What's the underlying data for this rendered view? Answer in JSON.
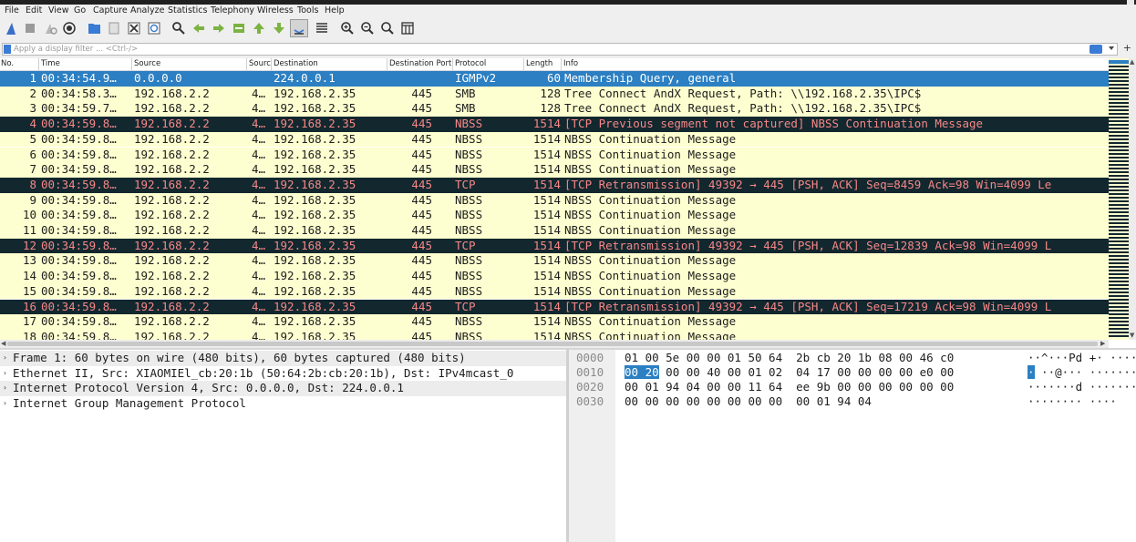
{
  "menu": [
    "File",
    "Edit",
    "View",
    "Go",
    "Capture",
    "Analyze",
    "Statistics",
    "Telephony",
    "Wireless",
    "Tools",
    "Help"
  ],
  "toolbar_icons": [
    "shark-fin-start-icon",
    "stop-capture-icon",
    "restart-capture-icon",
    "capture-options-icon",
    "open-file-icon",
    "save-file-icon",
    "close-file-icon",
    "reload-file-icon",
    "find-packet-icon",
    "go-back-icon",
    "go-forward-icon",
    "go-to-packet-icon",
    "go-first-icon",
    "go-last-icon",
    "autoscroll-icon",
    "colorize-icon",
    "zoom-in-icon",
    "zoom-out-icon",
    "zoom-normal-icon",
    "resize-columns-icon"
  ],
  "filter": {
    "placeholder": "Apply a display filter ... <Ctrl-/>",
    "plus": "+"
  },
  "columns": [
    "No.",
    "Time",
    "Source",
    "Source",
    "Destination",
    "Destination Port",
    "Protocol",
    "Length",
    "Info"
  ],
  "packets": [
    {
      "no": "1",
      "time": "00:34:54.9…",
      "src": "0.0.0.0",
      "sport": "",
      "dst": "224.0.0.1",
      "dport": "",
      "proto": "IGMPv2",
      "len": "60",
      "info": "Membership Query, general",
      "style": "sel"
    },
    {
      "no": "2",
      "time": "00:34:58.3…",
      "src": "192.168.2.2",
      "sport": "4…",
      "dst": "192.168.2.35",
      "dport": "445",
      "proto": "SMB",
      "len": "128",
      "info": "Tree Connect AndX Request, Path: \\\\192.168.2.35\\IPC$",
      "style": "y"
    },
    {
      "no": "3",
      "time": "00:34:59.7…",
      "src": "192.168.2.2",
      "sport": "4…",
      "dst": "192.168.2.35",
      "dport": "445",
      "proto": "SMB",
      "len": "128",
      "info": "Tree Connect AndX Request, Path: \\\\192.168.2.35\\IPC$",
      "style": "y"
    },
    {
      "no": "4",
      "time": "00:34:59.8…",
      "src": "192.168.2.2",
      "sport": "4…",
      "dst": "192.168.2.35",
      "dport": "445",
      "proto": "NBSS",
      "len": "1514",
      "info": "[TCP Previous segment not captured] NBSS Continuation Message",
      "style": "bad"
    },
    {
      "no": "5",
      "time": "00:34:59.8…",
      "src": "192.168.2.2",
      "sport": "4…",
      "dst": "192.168.2.35",
      "dport": "445",
      "proto": "NBSS",
      "len": "1514",
      "info": "NBSS Continuation Message",
      "style": "y"
    },
    {
      "no": "6",
      "time": "00:34:59.8…",
      "src": "192.168.2.2",
      "sport": "4…",
      "dst": "192.168.2.35",
      "dport": "445",
      "proto": "NBSS",
      "len": "1514",
      "info": "NBSS Continuation Message",
      "style": "y"
    },
    {
      "no": "7",
      "time": "00:34:59.8…",
      "src": "192.168.2.2",
      "sport": "4…",
      "dst": "192.168.2.35",
      "dport": "445",
      "proto": "NBSS",
      "len": "1514",
      "info": "NBSS Continuation Message",
      "style": "y"
    },
    {
      "no": "8",
      "time": "00:34:59.8…",
      "src": "192.168.2.2",
      "sport": "4…",
      "dst": "192.168.2.35",
      "dport": "445",
      "proto": "TCP",
      "len": "1514",
      "info": "[TCP Retransmission] 49392 → 445 [PSH, ACK] Seq=8459 Ack=98 Win=4099 Le",
      "style": "bad"
    },
    {
      "no": "9",
      "time": "00:34:59.8…",
      "src": "192.168.2.2",
      "sport": "4…",
      "dst": "192.168.2.35",
      "dport": "445",
      "proto": "NBSS",
      "len": "1514",
      "info": "NBSS Continuation Message",
      "style": "y"
    },
    {
      "no": "10",
      "time": "00:34:59.8…",
      "src": "192.168.2.2",
      "sport": "4…",
      "dst": "192.168.2.35",
      "dport": "445",
      "proto": "NBSS",
      "len": "1514",
      "info": "NBSS Continuation Message",
      "style": "y"
    },
    {
      "no": "11",
      "time": "00:34:59.8…",
      "src": "192.168.2.2",
      "sport": "4…",
      "dst": "192.168.2.35",
      "dport": "445",
      "proto": "NBSS",
      "len": "1514",
      "info": "NBSS Continuation Message",
      "style": "y"
    },
    {
      "no": "12",
      "time": "00:34:59.8…",
      "src": "192.168.2.2",
      "sport": "4…",
      "dst": "192.168.2.35",
      "dport": "445",
      "proto": "TCP",
      "len": "1514",
      "info": "[TCP Retransmission] 49392 → 445 [PSH, ACK] Seq=12839 Ack=98 Win=4099 L",
      "style": "bad"
    },
    {
      "no": "13",
      "time": "00:34:59.8…",
      "src": "192.168.2.2",
      "sport": "4…",
      "dst": "192.168.2.35",
      "dport": "445",
      "proto": "NBSS",
      "len": "1514",
      "info": "NBSS Continuation Message",
      "style": "y"
    },
    {
      "no": "14",
      "time": "00:34:59.8…",
      "src": "192.168.2.2",
      "sport": "4…",
      "dst": "192.168.2.35",
      "dport": "445",
      "proto": "NBSS",
      "len": "1514",
      "info": "NBSS Continuation Message",
      "style": "y"
    },
    {
      "no": "15",
      "time": "00:34:59.8…",
      "src": "192.168.2.2",
      "sport": "4…",
      "dst": "192.168.2.35",
      "dport": "445",
      "proto": "NBSS",
      "len": "1514",
      "info": "NBSS Continuation Message",
      "style": "y"
    },
    {
      "no": "16",
      "time": "00:34:59.8…",
      "src": "192.168.2.2",
      "sport": "4…",
      "dst": "192.168.2.35",
      "dport": "445",
      "proto": "TCP",
      "len": "1514",
      "info": "[TCP Retransmission] 49392 → 445 [PSH, ACK] Seq=17219 Ack=98 Win=4099 L",
      "style": "bad"
    },
    {
      "no": "17",
      "time": "00:34:59.8…",
      "src": "192.168.2.2",
      "sport": "4…",
      "dst": "192.168.2.35",
      "dport": "445",
      "proto": "NBSS",
      "len": "1514",
      "info": "NBSS Continuation Message",
      "style": "y"
    },
    {
      "no": "18",
      "time": "00:34:59.8…",
      "src": "192.168.2.2",
      "sport": "4…",
      "dst": "192.168.2.35",
      "dport": "445",
      "proto": "NBSS",
      "len": "1514",
      "info": "NBSS Continuation Message",
      "style": "y"
    }
  ],
  "details": [
    "Frame 1: 60 bytes on wire (480 bits), 60 bytes captured (480 bits)",
    "Ethernet II, Src: XIAOMIEl_cb:20:1b (50:64:2b:cb:20:1b), Dst: IPv4mcast_0",
    "Internet Protocol Version 4, Src: 0.0.0.0, Dst: 224.0.0.1",
    "Internet Group Management Protocol"
  ],
  "expander": "›",
  "bytes": [
    {
      "off": "0000",
      "hex_pre": "",
      "hex_hl": "",
      "hex_post": "01 00 5e 00 00 01 50 64  2b cb 20 1b 08 00 46 c0",
      "asc_pre": "",
      "asc_hl": "",
      "asc_post": "··^···Pd +· ·····F·"
    },
    {
      "off": "0010",
      "hex_pre": "",
      "hex_hl": "00 20",
      "hex_post": " 00 00 40 00 01 02  04 17 00 00 00 00 e0 00",
      "asc_pre": "",
      "asc_hl": "·",
      "asc_post": " ··@··· ········"
    },
    {
      "off": "0020",
      "hex_pre": "",
      "hex_hl": "",
      "hex_post": "00 01 94 04 00 00 11 64  ee 9b 00 00 00 00 00 00",
      "asc_pre": "",
      "asc_hl": "",
      "asc_post": "·······d ········"
    },
    {
      "off": "0030",
      "hex_pre": "",
      "hex_hl": "",
      "hex_post": "00 00 00 00 00 00 00 00  00 01 94 04",
      "asc_pre": "",
      "asc_hl": "",
      "asc_post": "········ ····"
    }
  ]
}
